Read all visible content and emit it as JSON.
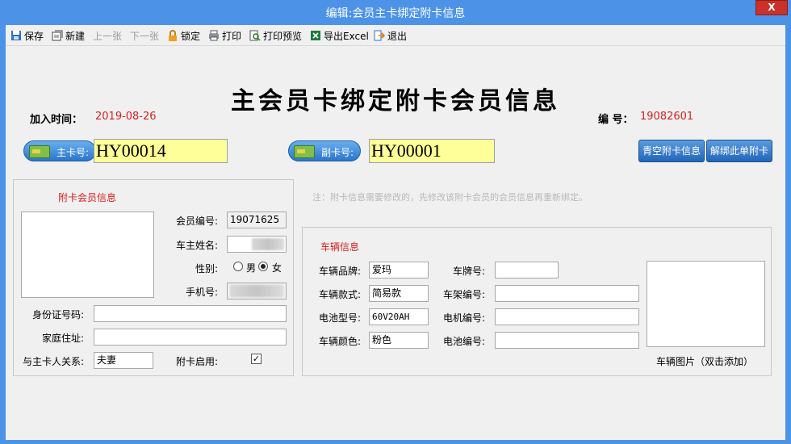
{
  "window": {
    "title": "编辑:会员主卡绑定附卡信息",
    "close_label": "X"
  },
  "toolbar": {
    "save": "保存",
    "new": "新建",
    "prev": "上一张",
    "next": "下一张",
    "lock": "锁定",
    "print": "打印",
    "print_preview": "打印预览",
    "export_excel": "导出Excel",
    "exit": "退出"
  },
  "form": {
    "heading": "主会员卡绑定附卡会员信息",
    "join_time_label": "加入时间：",
    "join_time": "2019-08-26",
    "number_label": "编 号：",
    "number": "19082601",
    "main_card_label": "主卡号:",
    "main_card_value": "HY00014",
    "sub_card_label": "副卡号:",
    "sub_card_value": "HY00001",
    "clear_button": "青空附卡信息",
    "unbind_button": "解绑此单附卡",
    "note": "注：附卡信息需要修改的，先修改该附卡会员的会员信息再重新绑定。"
  },
  "member": {
    "group_title": "附卡会员信息",
    "member_no_label": "会员编号:",
    "member_no": "19071625",
    "owner_name_label": "车主姓名:",
    "gender_label": "性别:",
    "gender_male": "男",
    "gender_female": "女",
    "gender_selected": "女",
    "phone_label": "手机号:",
    "id_label": "身份证号码:",
    "id_value": "",
    "address_label": "家庭住址:",
    "address_value": "",
    "relation_label": "与主卡人关系:",
    "relation_value": "夫妻",
    "enabled_label": "附卡启用:",
    "enabled_mark": "✓"
  },
  "vehicle": {
    "group_title": "车辆信息",
    "brand_label": "车辆品牌:",
    "brand": "爱玛",
    "model_label": "车辆款式:",
    "model": "简易款",
    "battery_type_label": "电池型号:",
    "battery_type": "60V20AH",
    "color_label": "车辆颜色:",
    "color": "粉色",
    "plate_label": "车牌号:",
    "plate": "",
    "frame_label": "车架编号:",
    "frame": "",
    "motor_label": "电机编号:",
    "motor": "",
    "battery_no_label": "电池编号:",
    "battery_no": "",
    "photo_caption": "车辆图片（双击添加）"
  },
  "colors": {
    "title_bar": "#4c93e8",
    "accent_red": "#d62020",
    "highlight_input": "#ffff99"
  },
  "icons": [
    "save-icon",
    "new-icon",
    "lock-icon",
    "print-icon",
    "print-preview-icon",
    "excel-icon",
    "exit-icon",
    "card-icon"
  ]
}
